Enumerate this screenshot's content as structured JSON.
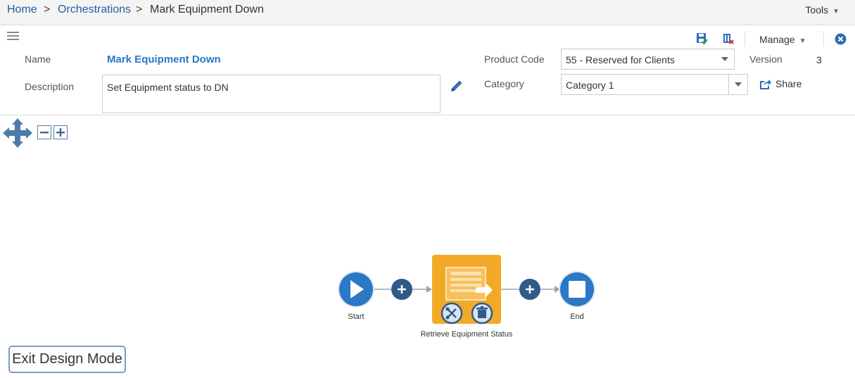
{
  "breadcrumb": {
    "home": "Home",
    "sep1": ">",
    "orchestrations": "Orchestrations",
    "sep2": ">",
    "current": "Mark Equipment Down"
  },
  "tools_label": "Tools",
  "header": {
    "name_label": "Name",
    "name_value": "Mark Equipment Down",
    "description_label": "Description",
    "description_value": "Set Equipment status to DN",
    "product_code_label": "Product Code",
    "product_code_value": "55 - Reserved for Clients",
    "category_label": "Category",
    "category_value": "Category 1",
    "version_label": "Version",
    "version_value": "3",
    "share_label": "Share",
    "manage_label": "Manage"
  },
  "flow": {
    "start_label": "Start",
    "step_label": "Retrieve Equipment Status",
    "end_label": "End"
  },
  "exit_button": "Exit Design Mode",
  "colors": {
    "link": "#1f5f9f",
    "accent_blue": "#2a78c6",
    "node_dark": "#2f5a8a",
    "node_orange": "#f2a928"
  },
  "icons": [
    "hamburger-icon",
    "save-icon",
    "delete-icon",
    "close-icon",
    "pencil-icon",
    "share-icon",
    "pan-icon",
    "zoom-out-icon",
    "zoom-in-icon",
    "play-icon",
    "add-step-icon",
    "table-icon",
    "scissors-icon",
    "trash-icon",
    "stop-icon"
  ]
}
